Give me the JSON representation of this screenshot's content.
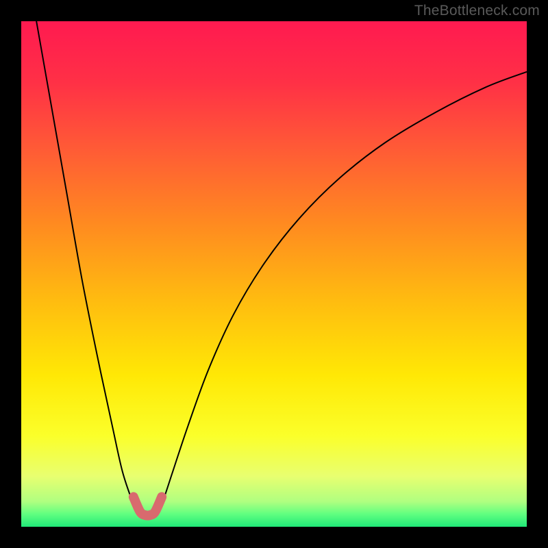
{
  "watermark": "TheBottleneck.com",
  "chart_data": {
    "type": "line",
    "title": "",
    "xlabel": "",
    "ylabel": "",
    "xlim": [
      0,
      100
    ],
    "ylim": [
      0,
      100
    ],
    "series": [
      {
        "name": "curve",
        "x": [
          3,
          6,
          9,
          12,
          15,
          18,
          20,
          22,
          23,
          24,
          25,
          26,
          27,
          28,
          30,
          33,
          37,
          42,
          48,
          55,
          63,
          72,
          82,
          92,
          100
        ],
        "y": [
          100,
          83,
          66,
          49,
          34,
          20,
          11,
          5,
          3,
          2,
          2,
          2,
          3,
          5,
          11,
          20,
          31,
          42,
          52,
          61,
          69,
          76,
          82,
          87,
          90
        ]
      },
      {
        "name": "highlight",
        "x": [
          22.2,
          23.5,
          24.5,
          25.5,
          26.5,
          27.8
        ],
        "y": [
          5.9,
          3.0,
          2.3,
          2.3,
          3.0,
          5.9
        ]
      }
    ],
    "gradient_stops": [
      {
        "pos": 0.0,
        "color": "#ff1a50"
      },
      {
        "pos": 0.12,
        "color": "#ff3046"
      },
      {
        "pos": 0.25,
        "color": "#ff5a36"
      },
      {
        "pos": 0.4,
        "color": "#ff8a20"
      },
      {
        "pos": 0.55,
        "color": "#ffbb10"
      },
      {
        "pos": 0.7,
        "color": "#ffe805"
      },
      {
        "pos": 0.82,
        "color": "#fbff2a"
      },
      {
        "pos": 0.9,
        "color": "#e8ff70"
      },
      {
        "pos": 0.95,
        "color": "#b0ff80"
      },
      {
        "pos": 0.975,
        "color": "#60ff80"
      },
      {
        "pos": 1.0,
        "color": "#20e878"
      }
    ]
  }
}
